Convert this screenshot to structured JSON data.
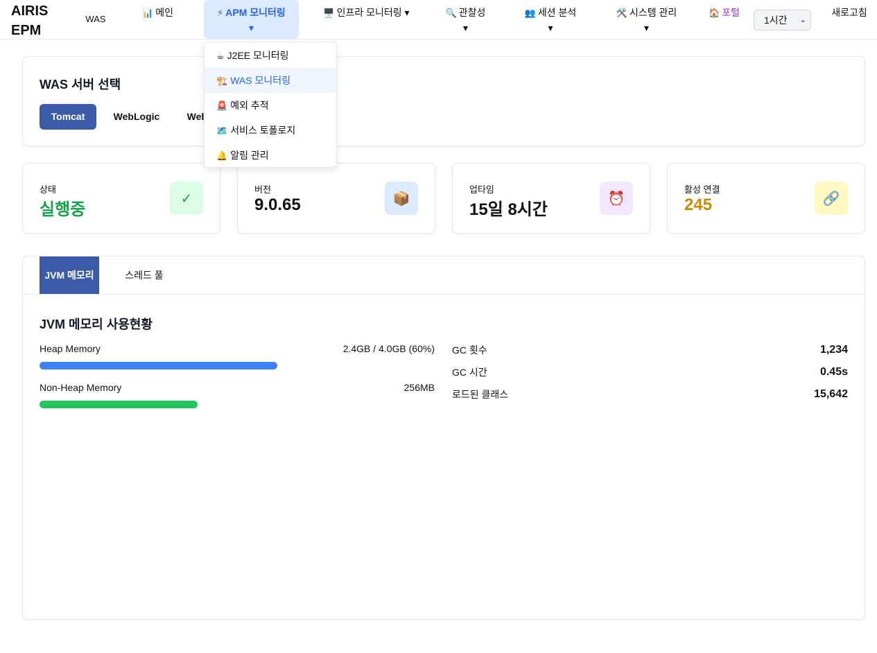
{
  "brand": {
    "line1": "AIRIS",
    "line2": "EPM"
  },
  "nav": {
    "was": "WAS",
    "main": {
      "icon": "📊",
      "label": "메인"
    },
    "apm": {
      "icon": "⚡",
      "label": "APM 모니터링",
      "caret": "▾"
    },
    "infra": {
      "icon": "🖥️",
      "label": "인프라 모니터링",
      "caret": "▾"
    },
    "observability": {
      "icon": "🔍",
      "label": "관찰성",
      "caret": "▾"
    },
    "session": {
      "icon": "👥",
      "label": "세션 분석",
      "caret": "▾"
    },
    "system": {
      "icon": "🛠️",
      "label": "시스템 관리",
      "caret": "▾"
    },
    "portal": {
      "icon": "🏠",
      "label": "포털"
    },
    "time_range": "1시간",
    "refresh": "새로고침"
  },
  "apm_menu": [
    {
      "icon": "☕",
      "label": "J2EE 모니터링"
    },
    {
      "icon": "🏗️",
      "label": "WAS 모니터링"
    },
    {
      "icon": "🚨",
      "label": "예외 추적"
    },
    {
      "icon": "🗺️",
      "label": "서비스 토폴로지"
    },
    {
      "icon": "🔔",
      "label": "알림 관리"
    }
  ],
  "server_select": {
    "title": "WAS 서버 선택",
    "options": [
      "Tomcat",
      "WebLogic",
      "WebSphere"
    ],
    "selected": "Tomcat"
  },
  "stats": [
    {
      "label": "상태",
      "value": "실행중",
      "icon": "✓",
      "value_color": "#16a34a",
      "icon_bg": "#dcfce7",
      "icon_color": "#16a34a"
    },
    {
      "label": "버전",
      "value": "9.0.65",
      "icon": "📦",
      "value_color": "#111111",
      "icon_bg": "#dbeafe",
      "icon_color": "#b45309"
    },
    {
      "label": "업타임",
      "value": "15일 8시간",
      "icon": "⏰",
      "value_color": "#111111",
      "icon_bg": "#f3e8ff",
      "icon_color": "#dc2626"
    },
    {
      "label": "활성 연결",
      "value": "245",
      "icon": "🔗",
      "value_color": "#ca8a04",
      "icon_bg": "#fef9c3",
      "icon_color": "#2563eb"
    }
  ],
  "tabs": {
    "jvm": "JVM 메모리",
    "thread": "스레드 풀",
    "active": "jvm"
  },
  "jvm": {
    "title": "JVM 메모리 사용현황",
    "heap": {
      "label": "Heap Memory",
      "value": "2.4GB / 4.0GB (60%)",
      "percent": 60,
      "color": "#3b82f6"
    },
    "nonheap": {
      "label": "Non-Heap Memory",
      "value": "256MB",
      "color": "#22c55e"
    },
    "metrics": [
      {
        "label": "GC 횟수",
        "value": "1,234"
      },
      {
        "label": "GC 시간",
        "value": "0.45s"
      },
      {
        "label": "로드된 클래스",
        "value": "15,642"
      }
    ]
  }
}
